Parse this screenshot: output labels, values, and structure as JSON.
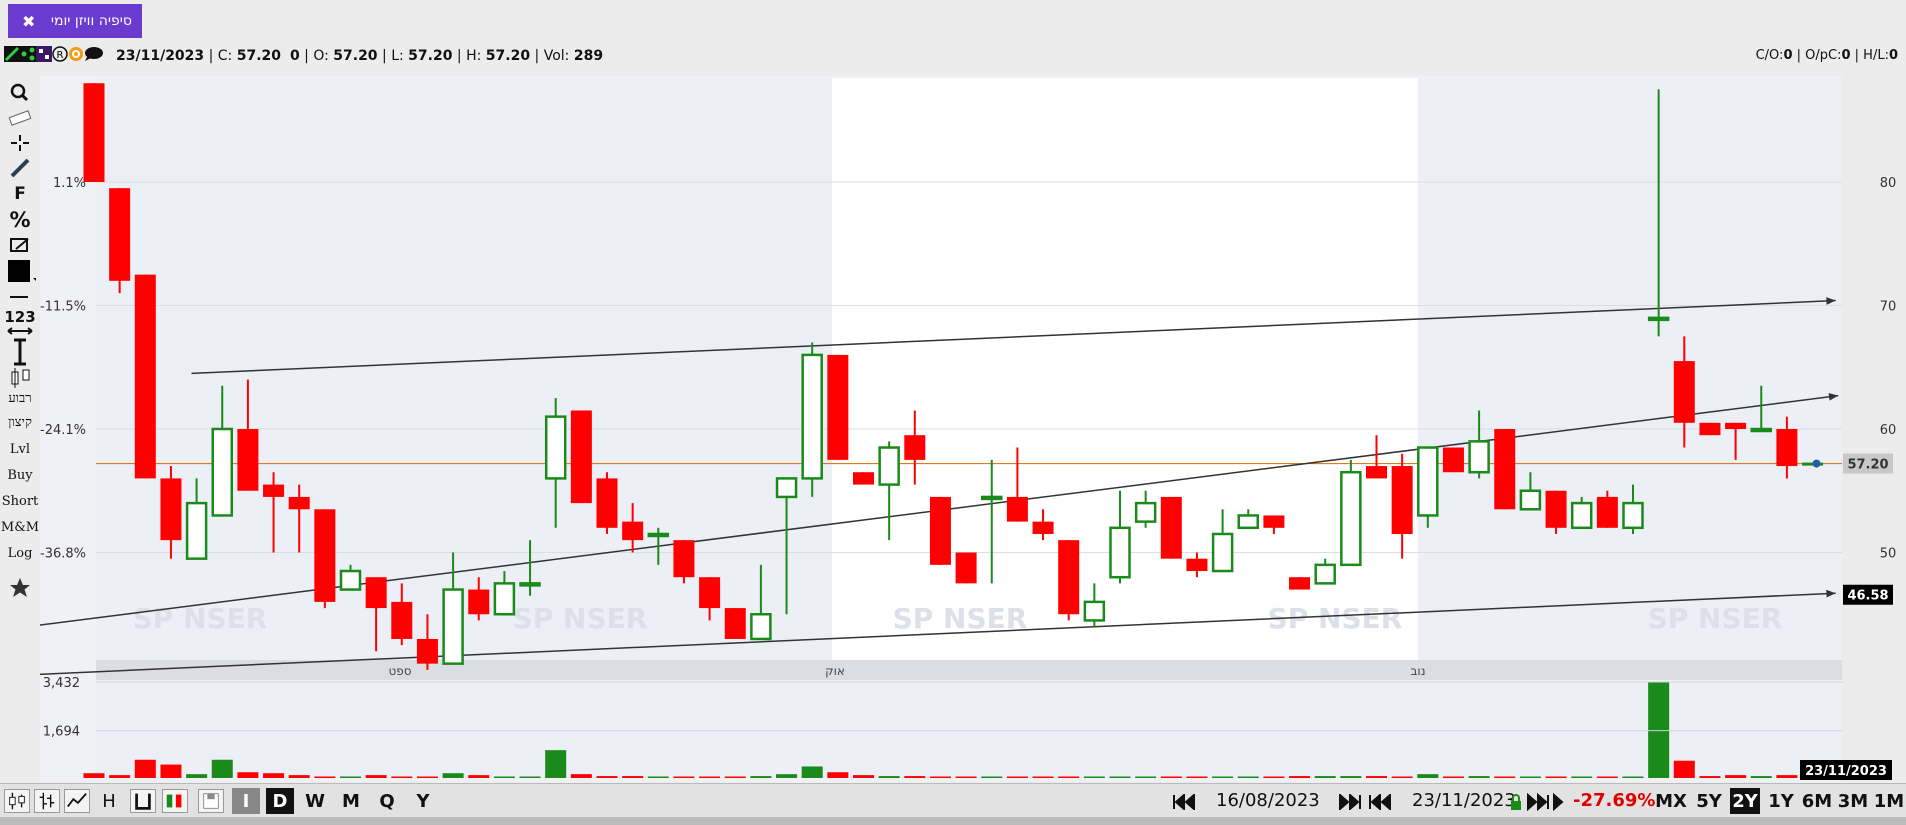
{
  "tab": {
    "title": "סיפיה וויזן יומי",
    "close": "✖"
  },
  "info": {
    "date": "23/11/2023",
    "c_label": "C:",
    "c_value": "57.20",
    "c_change": "0",
    "o_label": "O:",
    "o_value": "57.20",
    "l_label": "L:",
    "l_value": "57.20",
    "h_label": "H:",
    "h_value": "57.20",
    "vol_label": "Vol:",
    "vol_value": "289",
    "right": {
      "co_label": "C/O:",
      "co_value": "0",
      "opc_label": "O/pC:",
      "opc_value": "0",
      "hl_label": "H/L:",
      "hl_value": "0"
    }
  },
  "tools": {
    "f": "F",
    "pct": "%",
    "num": "123",
    "lvl": "Lvl",
    "buy": "Buy",
    "short": "Short",
    "mm": "M&M",
    "log": "Log",
    "heb1": "רבוע",
    "heb2": "קיצון"
  },
  "watermark": "SP   NSER",
  "bottom": {
    "date_from": "16/08/2023",
    "date_to": "23/11/2023",
    "change": "-27.69%",
    "ranges": [
      "MX",
      "5Y",
      "2Y",
      "1Y",
      "6M",
      "3M",
      "1M"
    ],
    "selected_range": "2Y",
    "intervals": [
      "I",
      "D",
      "W",
      "M",
      "Q",
      "Y"
    ],
    "selected_interval": "D",
    "h_label": "H"
  },
  "chart_data": {
    "type": "candlestick",
    "colors": {
      "up": "#1a8a1a",
      "down": "#ff0000",
      "current_line": "#e07a1a",
      "trend": "#333333"
    },
    "price_axis": {
      "ticks": [
        50,
        60,
        70,
        80
      ],
      "range": [
        39,
        88.5
      ]
    },
    "pct_axis": {
      "ticks": [
        "1.1%",
        "-11.5%",
        "-24.1%",
        "-36.8%"
      ]
    },
    "current_price_label": "57.20",
    "level_label": "46.58",
    "current_date_label": "23/11/2023",
    "x_labels": [
      "ספט",
      "אוק",
      "נוב"
    ],
    "volume_axis": {
      "ticks": [
        "3,432",
        "1,694"
      ]
    },
    "candles": [
      {
        "o": 88,
        "h": 88,
        "l": 80,
        "c": 80
      },
      {
        "o": 79.5,
        "h": 79.5,
        "l": 71,
        "c": 72
      },
      {
        "o": 72.5,
        "h": 72.5,
        "l": 56,
        "c": 56
      },
      {
        "o": 56,
        "h": 57,
        "l": 49.5,
        "c": 51
      },
      {
        "o": 49.5,
        "h": 56,
        "l": 49.5,
        "c": 54
      },
      {
        "o": 53,
        "h": 63.5,
        "l": 53,
        "c": 60
      },
      {
        "o": 60,
        "h": 64,
        "l": 55,
        "c": 55
      },
      {
        "o": 55.5,
        "h": 56.5,
        "l": 50,
        "c": 54.5
      },
      {
        "o": 54.5,
        "h": 55.5,
        "l": 50,
        "c": 53.5
      },
      {
        "o": 53.5,
        "h": 53.5,
        "l": 45.5,
        "c": 46
      },
      {
        "o": 47,
        "h": 49,
        "l": 47,
        "c": 48.5
      },
      {
        "o": 48,
        "h": 48,
        "l": 42,
        "c": 45.5
      },
      {
        "o": 46,
        "h": 47.5,
        "l": 42.5,
        "c": 43
      },
      {
        "o": 43,
        "h": 45,
        "l": 40.5,
        "c": 41
      },
      {
        "o": 41,
        "h": 50,
        "l": 41,
        "c": 47
      },
      {
        "o": 47,
        "h": 48,
        "l": 44.5,
        "c": 45
      },
      {
        "o": 45,
        "h": 48.5,
        "l": 45,
        "c": 47.5
      },
      {
        "o": 47.5,
        "h": 51,
        "l": 46.5,
        "c": 47.5
      },
      {
        "o": 56,
        "h": 62.5,
        "l": 52,
        "c": 61
      },
      {
        "o": 61.5,
        "h": 61.5,
        "l": 54,
        "c": 54
      },
      {
        "o": 56,
        "h": 56.5,
        "l": 51.5,
        "c": 52
      },
      {
        "o": 52.5,
        "h": 54,
        "l": 50,
        "c": 51
      },
      {
        "o": 51.5,
        "h": 52,
        "l": 49,
        "c": 51.5
      },
      {
        "o": 51,
        "h": 51,
        "l": 47.5,
        "c": 48
      },
      {
        "o": 48,
        "h": 48,
        "l": 44.5,
        "c": 45.5
      },
      {
        "o": 45.5,
        "h": 45.5,
        "l": 43,
        "c": 43
      },
      {
        "o": 43,
        "h": 49,
        "l": 43,
        "c": 45
      },
      {
        "o": 54.5,
        "h": 56,
        "l": 45,
        "c": 56
      },
      {
        "o": 56,
        "h": 67,
        "l": 54.5,
        "c": 66
      },
      {
        "o": 66,
        "h": 66,
        "l": 57.5,
        "c": 57.5
      },
      {
        "o": 56.5,
        "h": 56.5,
        "l": 55.5,
        "c": 55.5
      },
      {
        "o": 55.5,
        "h": 59,
        "l": 51,
        "c": 58.5
      },
      {
        "o": 59.5,
        "h": 61.5,
        "l": 55.5,
        "c": 57.5
      },
      {
        "o": 54.5,
        "h": 54.5,
        "l": 49,
        "c": 49
      },
      {
        "o": 50,
        "h": 50,
        "l": 47.5,
        "c": 47.5
      },
      {
        "o": 54.5,
        "h": 57.5,
        "l": 47.5,
        "c": 54.5
      },
      {
        "o": 54.5,
        "h": 58.5,
        "l": 52.5,
        "c": 52.5
      },
      {
        "o": 52.5,
        "h": 53.5,
        "l": 51,
        "c": 51.5
      },
      {
        "o": 51,
        "h": 51,
        "l": 44.5,
        "c": 45
      },
      {
        "o": 44.5,
        "h": 47.5,
        "l": 44,
        "c": 46
      },
      {
        "o": 48,
        "h": 55,
        "l": 47.5,
        "c": 52
      },
      {
        "o": 52.5,
        "h": 55,
        "l": 52,
        "c": 54
      },
      {
        "o": 54.5,
        "h": 54.5,
        "l": 49.5,
        "c": 49.5
      },
      {
        "o": 49.5,
        "h": 50,
        "l": 48,
        "c": 48.5
      },
      {
        "o": 48.5,
        "h": 53.5,
        "l": 48.5,
        "c": 51.5
      },
      {
        "o": 52,
        "h": 53.5,
        "l": 52,
        "c": 53
      },
      {
        "o": 53,
        "h": 53,
        "l": 51.5,
        "c": 52
      },
      {
        "o": 48,
        "h": 48,
        "l": 47,
        "c": 47
      },
      {
        "o": 47.5,
        "h": 49.5,
        "l": 47.5,
        "c": 49
      },
      {
        "o": 49,
        "h": 57.5,
        "l": 49,
        "c": 56.5
      },
      {
        "o": 57,
        "h": 59.5,
        "l": 56,
        "c": 56
      },
      {
        "o": 57,
        "h": 58,
        "l": 49.5,
        "c": 51.5
      },
      {
        "o": 53,
        "h": 58.5,
        "l": 52,
        "c": 58.5
      },
      {
        "o": 58.5,
        "h": 58.5,
        "l": 56.5,
        "c": 56.5
      },
      {
        "o": 56.5,
        "h": 61.5,
        "l": 56,
        "c": 59
      },
      {
        "o": 60,
        "h": 60,
        "l": 53.5,
        "c": 53.5
      },
      {
        "o": 53.5,
        "h": 56.5,
        "l": 53.5,
        "c": 55
      },
      {
        "o": 55,
        "h": 55,
        "l": 51.5,
        "c": 52
      },
      {
        "o": 52,
        "h": 54.5,
        "l": 52,
        "c": 54
      },
      {
        "o": 54.5,
        "h": 55,
        "l": 52,
        "c": 52
      },
      {
        "o": 52,
        "h": 55.5,
        "l": 51.5,
        "c": 54
      },
      {
        "o": 69,
        "h": 87.5,
        "l": 67.5,
        "c": 69
      },
      {
        "o": 65.5,
        "h": 67.5,
        "l": 58.5,
        "c": 60.5
      },
      {
        "o": 60.5,
        "h": 60.5,
        "l": 59.5,
        "c": 59.5
      },
      {
        "o": 60.5,
        "h": 60.5,
        "l": 57.5,
        "c": 60
      },
      {
        "o": 60,
        "h": 63.5,
        "l": 60,
        "c": 60
      },
      {
        "o": 60,
        "h": 61,
        "l": 56,
        "c": 57
      },
      {
        "o": 57.2,
        "h": 57.2,
        "l": 57.2,
        "c": 57.2
      }
    ],
    "volumes": [
      0.05,
      0.03,
      0.19,
      0.14,
      0.04,
      0.19,
      0.06,
      0.05,
      0.03,
      0.01,
      0.01,
      0.03,
      0.01,
      0.01,
      0.05,
      0.03,
      0.01,
      0.01,
      0.29,
      0.04,
      0.02,
      0.02,
      0.01,
      0.01,
      0.01,
      0.01,
      0.02,
      0.04,
      0.12,
      0.06,
      0.03,
      0.02,
      0.02,
      0.01,
      0.01,
      0.01,
      0.01,
      0.01,
      0.01,
      0.01,
      0.01,
      0.01,
      0.01,
      0.01,
      0.01,
      0.01,
      0.01,
      0.02,
      0.02,
      0.02,
      0.02,
      0.01,
      0.04,
      0.01,
      0.02,
      0.01,
      0.01,
      0.01,
      0.01,
      0.01,
      0.01,
      1.0,
      0.18,
      0.02,
      0.03,
      0.02,
      0.03,
      0.01
    ],
    "trendlines": [
      {
        "from": [
          -5.6,
          43.2
        ],
        "to": [
          68,
          62.7
        ]
      },
      {
        "from": [
          3.8,
          64.5
        ],
        "to": [
          67.9,
          70.4
        ]
      },
      {
        "from": [
          -4.6,
          39.9
        ],
        "to": [
          67.9,
          46.7
        ]
      }
    ]
  }
}
